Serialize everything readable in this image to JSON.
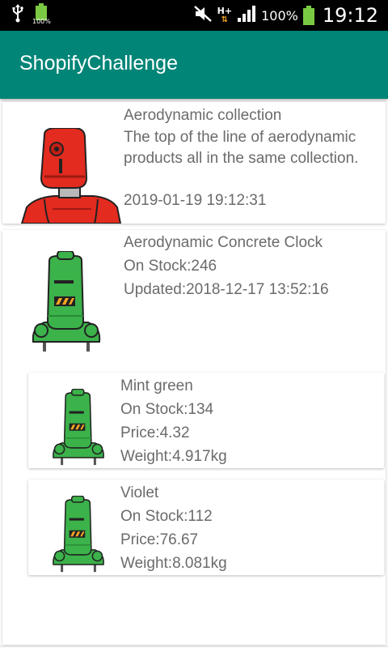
{
  "status_bar": {
    "battery_small_pct": "100%",
    "battery_pct": "100%",
    "network": "H+",
    "time": "19:12"
  },
  "app_bar": {
    "title": "ShopifyChallenge"
  },
  "collection": {
    "title": "Aerodynamic collection",
    "description": "The top of the line of aerodynamic products all in the same collection.",
    "date": "2019-01-19 19:12:31"
  },
  "product": {
    "title": "Aerodynamic Concrete Clock",
    "stock": "On Stock:246",
    "updated": "Updated:2018-12-17 13:52:16",
    "variants": [
      {
        "title": "Mint green",
        "stock": "On Stock:134",
        "price": "Price:4.32",
        "weight": "Weight:4.917kg"
      },
      {
        "title": "Violet",
        "stock": "On Stock:112",
        "price": "Price:76.67",
        "weight": "Weight:8.081kg"
      }
    ]
  },
  "colors": {
    "app_bar": "#008577",
    "text": "#6b6b6b",
    "robot_red": "#e32b1f",
    "robot_green": "#3bb24a"
  }
}
